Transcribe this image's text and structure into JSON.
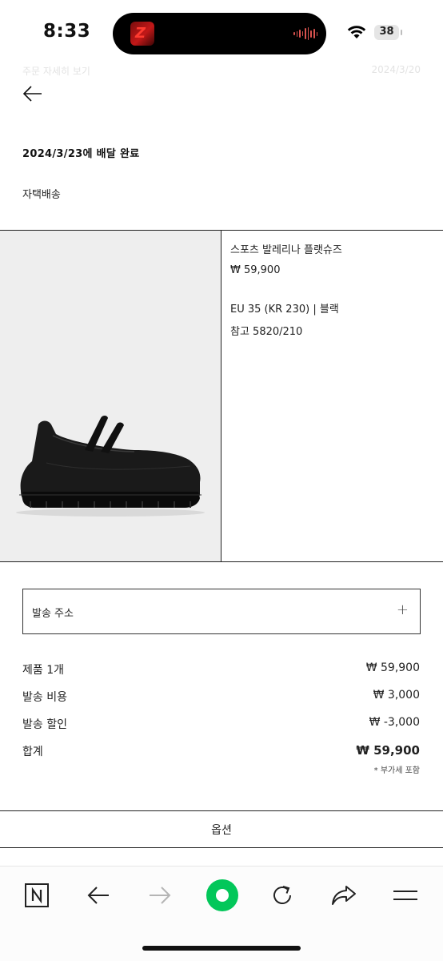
{
  "status_bar": {
    "time": "8:33",
    "battery": "38",
    "icons": [
      "now-playing-icon",
      "audio-waveform-icon",
      "wifi-icon",
      "battery-icon"
    ]
  },
  "header": {
    "faded_left": "주문 자세히 보기",
    "faded_right": "2024/3/20"
  },
  "order": {
    "delivered_status": "2024/3/23에 배달 완료",
    "delivery_method": "자택배송"
  },
  "product": {
    "image_icon": "black-platform-mary-jane-shoe",
    "name": "스포츠 발레리나 플랫슈즈",
    "price": "₩ 59,900",
    "variant": "EU 35 (KR 230) | 블랙",
    "reference": "참고 5820/210"
  },
  "shipping_address": {
    "label": "발송 주소",
    "expand_symbol": "+"
  },
  "summary": {
    "rows": [
      {
        "label": "제품 1개",
        "value": "₩ 59,900"
      },
      {
        "label": "발송 비용",
        "value": "₩ 3,000"
      },
      {
        "label": "발송 할인",
        "value": "₩ -3,000"
      },
      {
        "label": "합계",
        "value": "₩ 59,900"
      }
    ],
    "vat_note": "* 부가세 포함"
  },
  "options": {
    "label": "옵션"
  },
  "toolbar": {
    "buttons": [
      "naver-home-icon",
      "back-icon",
      "forward-icon",
      "green-dot-icon",
      "reload-icon",
      "share-icon",
      "menu-icon"
    ],
    "accent": "#03c75a"
  }
}
